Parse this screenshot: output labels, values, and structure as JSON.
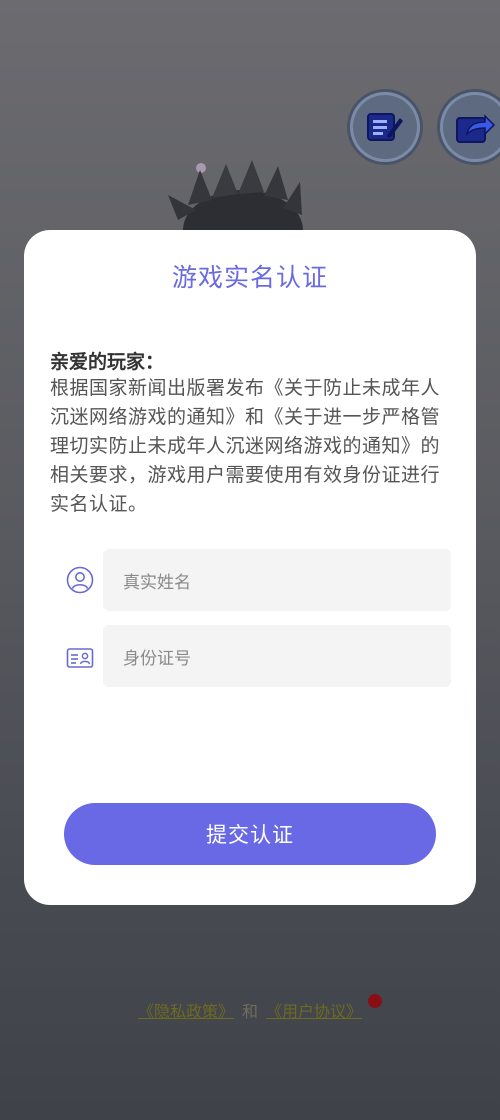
{
  "top_buttons": {
    "edit_icon": "edit-icon",
    "share_icon": "share-icon"
  },
  "modal": {
    "title": "游戏实名认证",
    "greeting": "亲爱的玩家：",
    "notice": "根据国家新闻出版署发布《关于防止未成年人沉迷网络游戏的通知》和《关于进一步严格管理切实防止未成年人沉迷网络游戏的通知》的相关要求，游戏用户需要使用有效身份证进行实名认证。",
    "name_placeholder": "真实姓名",
    "id_placeholder": "身份证号",
    "submit_label": "提交认证"
  },
  "footer": {
    "privacy_link": "《隐私政策》",
    "and_text": "和",
    "agreement_link": "《用户协议》"
  },
  "colors": {
    "accent": "#6969e6",
    "modal_bg": "#ffffff",
    "field_bg": "#f4f4f4"
  }
}
